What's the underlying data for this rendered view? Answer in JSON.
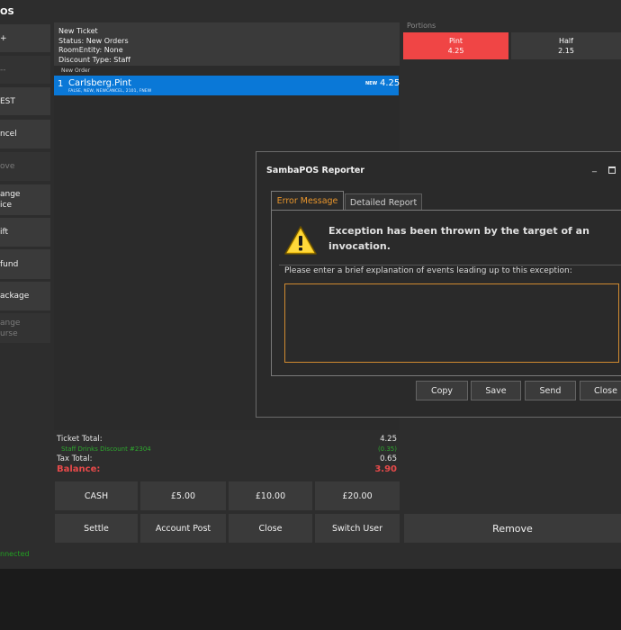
{
  "app": {
    "title_fragment": "OS"
  },
  "left_menu": [
    {
      "label": "+",
      "enabled": true
    },
    {
      "label": "--",
      "enabled": false
    },
    {
      "label": "EST",
      "enabled": true
    },
    {
      "label": "ncel",
      "enabled": true
    },
    {
      "label": "ove",
      "enabled": false
    },
    {
      "label": "ange\nice",
      "enabled": true
    },
    {
      "label": "ift",
      "enabled": true
    },
    {
      "label": "fund",
      "enabled": true
    },
    {
      "label": "ackage",
      "enabled": true
    },
    {
      "label": "ange\nurse",
      "enabled": false
    }
  ],
  "status": "nnected",
  "ticket": {
    "title": "New Ticket",
    "status_line": "Status: New Orders",
    "room_line": "RoomEntity: None",
    "discount_line": "Discount Type: Staff",
    "new_order_label": "New Order",
    "order": {
      "qty": "1",
      "name": "Carlsberg.Pint",
      "tags": "FALSE, NEW, NEWCANCEL, 2101, FNEW",
      "badge": "NEW",
      "price": "4.25"
    }
  },
  "totals": {
    "ticket_total_label": "Ticket Total:",
    "ticket_total": "4.25",
    "discount_label": "Staff Drinks Discount #2304",
    "discount": "(0.35)",
    "tax_label": "Tax Total:",
    "tax": "0.65",
    "balance_label": "Balance:",
    "balance": "3.90"
  },
  "payments": [
    "CASH",
    "£5.00",
    "£10.00",
    "£20.00"
  ],
  "actions": [
    "Settle",
    "Account Post",
    "Close",
    "Switch User"
  ],
  "remove_label": "Remove",
  "portions": {
    "label": "Portions",
    "items": [
      {
        "name": "Pint",
        "price": "4.25",
        "selected": true
      },
      {
        "name": "Half",
        "price": "2.15",
        "selected": false
      }
    ]
  },
  "dialog": {
    "title": "SambaPOS Reporter",
    "minimize": "_",
    "tabs": [
      "Error Message",
      "Detailed Report"
    ],
    "exception": "Exception has been thrown by the target of an invocation.",
    "hint": "Please enter a brief explanation of events leading up to this exception:",
    "buttons": [
      "Copy",
      "Save",
      "Send",
      "Close"
    ]
  },
  "colors": {
    "accent_blue": "#0a78d7",
    "selected_red": "#f04545",
    "discount_green": "#2ea82e",
    "balance_red": "#e84a4a",
    "tab_orange": "#e8952c"
  }
}
